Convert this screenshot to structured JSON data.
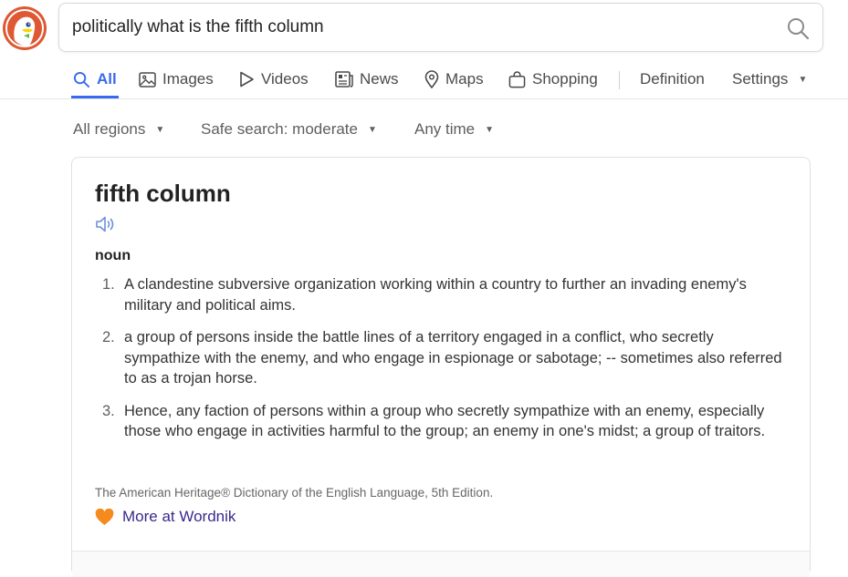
{
  "search": {
    "query": "politically what is the fifth column"
  },
  "tabs": [
    {
      "label": "All",
      "icon": "search-icon",
      "active": true
    },
    {
      "label": "Images",
      "icon": "image-icon"
    },
    {
      "label": "Videos",
      "icon": "play-icon"
    },
    {
      "label": "News",
      "icon": "newspaper-icon"
    },
    {
      "label": "Maps",
      "icon": "map-pin-icon"
    },
    {
      "label": "Shopping",
      "icon": "shopping-bag-icon"
    },
    {
      "label": "Definition"
    },
    {
      "label": "Settings",
      "icon": "chevron-down-icon"
    }
  ],
  "filters": {
    "region": "All regions",
    "safe_search": "Safe search: moderate",
    "time": "Any time"
  },
  "definition": {
    "word": "fifth column",
    "part_of_speech": "noun",
    "senses": [
      {
        "number": "1.",
        "text": "A clandestine subversive organization working within a country to further an invading enemy's military and political aims."
      },
      {
        "number": "2.",
        "text": "a group of persons inside the battle lines of a territory engaged in a conflict, who secretly sympathize with the enemy, and who engage in espionage or sabotage; -- sometimes also referred to as a trojan horse."
      },
      {
        "number": "3.",
        "text": "Hence, any faction of persons within a group who secretly sympathize with an enemy, especially those who engage in activities harmful to the group; an enemy in one's midst; a group of traitors."
      }
    ],
    "source": "The American Heritage® Dictionary of the English Language, 5th Edition.",
    "more_link": "More at Wordnik"
  },
  "colors": {
    "accent": "#3969ef",
    "brand": "#de5833",
    "link": "#3a2a8c",
    "heart": "#f58a1f"
  }
}
